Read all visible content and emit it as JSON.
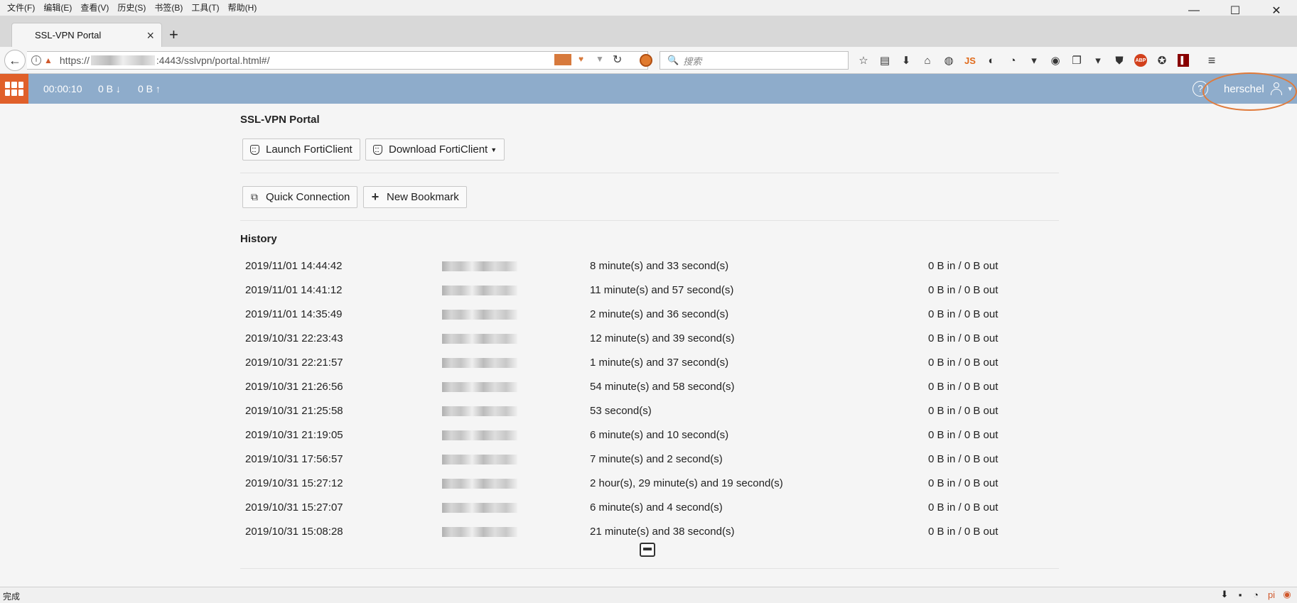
{
  "menubar": {
    "items": [
      "文件(F)",
      "编辑(E)",
      "查看(V)",
      "历史(S)",
      "书签(B)",
      "工具(T)",
      "帮助(H)"
    ]
  },
  "window_controls": {
    "minimize": "—",
    "maximize": "☐",
    "close": "✕"
  },
  "tab": {
    "title": "SSL-VPN Portal",
    "close": "×",
    "new": "+"
  },
  "navbar": {
    "url_prefix": "https://",
    "url_suffix": ":4443/sslvpn/portal.html#/",
    "search_placeholder": "搜索",
    "js_label": "JS",
    "abp_label": "ABP"
  },
  "header": {
    "timer": "00:00:10",
    "bytes_in": "0 B",
    "bytes_out": "0 B",
    "help": "?",
    "username": "herschel"
  },
  "portal": {
    "title": "SSL-VPN Portal",
    "launch_forticlient": "Launch FortiClient",
    "download_forticlient": "Download FortiClient",
    "quick_connection": "Quick Connection",
    "new_bookmark": "New Bookmark",
    "history_title": "History"
  },
  "history": [
    {
      "date": "2019/11/01 14:44:42",
      "duration": "8 minute(s) and 33 second(s)",
      "bytes": "0 B in / 0 B out"
    },
    {
      "date": "2019/11/01 14:41:12",
      "duration": "11 minute(s) and 57 second(s)",
      "bytes": "0 B in / 0 B out"
    },
    {
      "date": "2019/11/01 14:35:49",
      "duration": "2 minute(s) and 36 second(s)",
      "bytes": "0 B in / 0 B out"
    },
    {
      "date": "2019/10/31 22:23:43",
      "duration": "12 minute(s) and 39 second(s)",
      "bytes": "0 B in / 0 B out"
    },
    {
      "date": "2019/10/31 22:21:57",
      "duration": "1 minute(s) and 37 second(s)",
      "bytes": "0 B in / 0 B out"
    },
    {
      "date": "2019/10/31 21:26:56",
      "duration": "54 minute(s) and 58 second(s)",
      "bytes": "0 B in / 0 B out"
    },
    {
      "date": "2019/10/31 21:25:58",
      "duration": "53 second(s)",
      "bytes": "0 B in / 0 B out"
    },
    {
      "date": "2019/10/31 21:19:05",
      "duration": "6 minute(s) and 10 second(s)",
      "bytes": "0 B in / 0 B out"
    },
    {
      "date": "2019/10/31 17:56:57",
      "duration": "7 minute(s) and 2 second(s)",
      "bytes": "0 B in / 0 B out"
    },
    {
      "date": "2019/10/31 15:27:12",
      "duration": "2 hour(s), 29 minute(s) and 19 second(s)",
      "bytes": "0 B in / 0 B out"
    },
    {
      "date": "2019/10/31 15:27:07",
      "duration": "6 minute(s) and 4 second(s)",
      "bytes": "0 B in / 0 B out"
    },
    {
      "date": "2019/10/31 15:08:28",
      "duration": "21 minute(s) and 38 second(s)",
      "bytes": "0 B in / 0 B out"
    }
  ],
  "statusbar": {
    "text": "完成"
  },
  "colors": {
    "header_bg": "#8eaccb",
    "logo_bg": "#e0602a",
    "annotation": "#e07a3a"
  }
}
